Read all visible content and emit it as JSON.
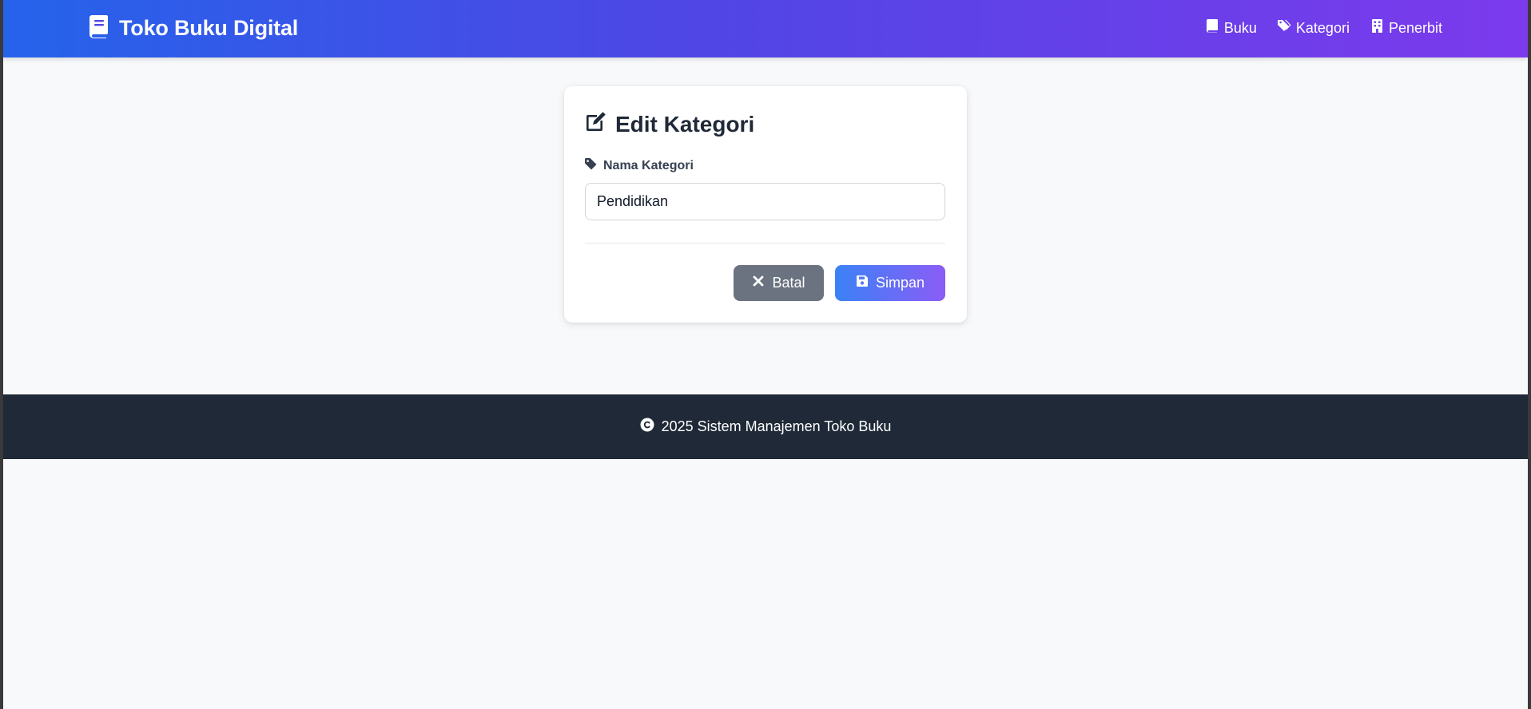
{
  "navbar": {
    "brand": "Toko Buku Digital",
    "brand_icon": "book-icon",
    "links": [
      {
        "label": "Buku",
        "icon": "book-icon"
      },
      {
        "label": "Kategori",
        "icon": "tags-icon"
      },
      {
        "label": "Penerbit",
        "icon": "building-icon"
      }
    ]
  },
  "form": {
    "title": "Edit Kategori",
    "title_icon": "edit-icon",
    "field_label": "Nama Kategori",
    "field_icon": "tag-icon",
    "field_value": "Pendidikan",
    "cancel_label": "Batal",
    "save_label": "Simpan"
  },
  "footer": {
    "text": "2025 Sistem Manajemen Toko Buku",
    "icon": "copyright-icon"
  },
  "colors": {
    "navbar_start": "#2563eb",
    "navbar_end": "#7c3aed",
    "cancel_button": "#6b7280",
    "save_start": "#3b82f6",
    "save_end": "#8b5cf6",
    "footer_bg": "#1f2937",
    "page_bg": "#f8f9fb"
  }
}
